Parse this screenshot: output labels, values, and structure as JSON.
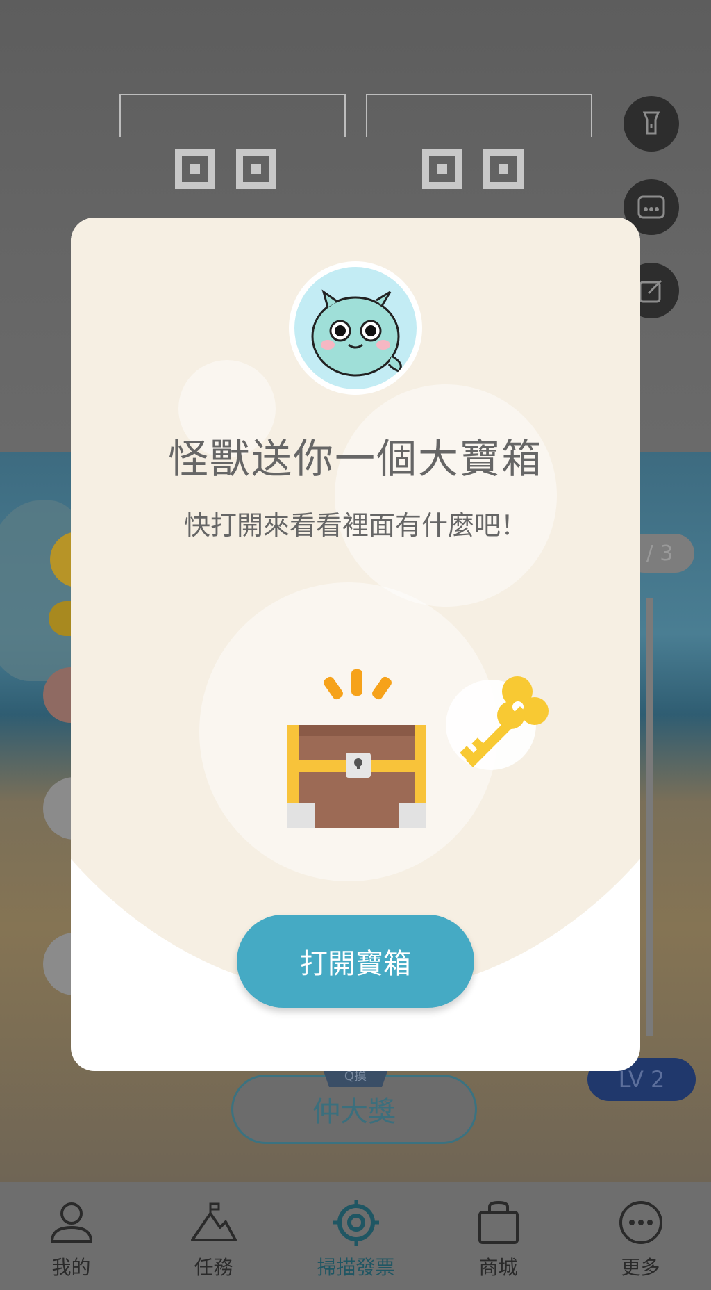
{
  "modal": {
    "title": "怪獸送你一個大寶箱",
    "subtitle": "快打開來看看裡面有什麼吧！",
    "open_button": "打開寶箱"
  },
  "background": {
    "lv_badge_top": "/ 3",
    "lv_badge": "LV 2",
    "prize_tag": "Q摸",
    "prize_button": "仲大獎"
  },
  "tabbar": {
    "items": [
      {
        "label": "我的",
        "icon": "person-icon"
      },
      {
        "label": "任務",
        "icon": "mountain-flag-icon"
      },
      {
        "label": "掃描發票",
        "icon": "scan-target-icon",
        "active": true
      },
      {
        "label": "商城",
        "icon": "shopping-bag-icon"
      },
      {
        "label": "更多",
        "icon": "more-icon"
      }
    ]
  },
  "side_buttons": [
    "flashlight-icon",
    "keyboard-icon",
    "edit-icon"
  ],
  "colors": {
    "accent": "#45aac4",
    "modal_top": "#f6efe3",
    "active_tab": "#1f5663"
  }
}
